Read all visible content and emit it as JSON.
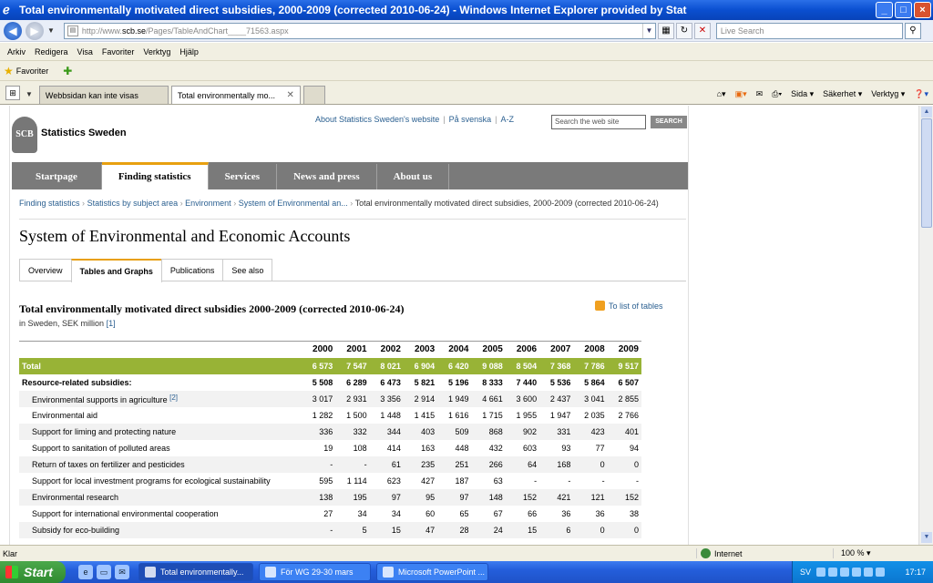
{
  "window": {
    "title": "Total environmentally motivated direct subsidies, 2000-2009 (corrected 2010-06-24) - Windows Internet Explorer provided by Stat",
    "min": "_",
    "max": "□",
    "close": "×"
  },
  "address": {
    "prefix": "http://www.",
    "domain": "scb.se",
    "rest": "/Pages/TableAndChart____71563.aspx",
    "search_placeholder": "Live Search"
  },
  "menu": [
    "Arkiv",
    "Redigera",
    "Visa",
    "Favoriter",
    "Verktyg",
    "Hjälp"
  ],
  "favorites": {
    "label": "Favoriter"
  },
  "tabs": [
    {
      "label": "Webbsidan kan inte visas"
    },
    {
      "label": "Total environmentally mo..."
    }
  ],
  "tab_tools": [
    "Sida ▾",
    "Säkerhet ▾",
    "Verktyg ▾"
  ],
  "site": {
    "logo_text": "SCB",
    "name": "Statistics Sweden",
    "top_links": [
      "About Statistics Sweden's website",
      "På svenska",
      "A-Z"
    ],
    "search_placeholder": "Search the web site",
    "search_button": "SEARCH",
    "nav": [
      "Startpage",
      "Finding statistics",
      "Services",
      "News and press",
      "About us"
    ],
    "breadcrumb": [
      "Finding statistics",
      "Statistics by subject area",
      "Environment",
      "System of Environmental an..."
    ],
    "breadcrumb_current": "Total environmentally motivated direct subsidies, 2000-2009 (corrected 2010-06-24)",
    "heading": "System of Environmental and Economic Accounts",
    "subtabs": [
      "Overview",
      "Tables and Graphs",
      "Publications",
      "See also"
    ],
    "table_title": "Total environmentally motivated direct subsidies 2000-2009 (corrected 2010-06-24)",
    "table_subtitle": "in Sweden, SEK million",
    "table_subtitle_ref": "[1]",
    "to_list": "To list of tables"
  },
  "table": {
    "years": [
      "2000",
      "2001",
      "2002",
      "2003",
      "2004",
      "2005",
      "2006",
      "2007",
      "2008",
      "2009"
    ],
    "rows": [
      {
        "label": "Total",
        "type": "total",
        "values": [
          "6 573",
          "7 547",
          "8 021",
          "6 904",
          "6 420",
          "9 088",
          "8 504",
          "7 368",
          "7 786",
          "9 517"
        ]
      },
      {
        "label": "Resource-related subsidies:",
        "type": "res",
        "values": [
          "5 508",
          "6 289",
          "6 473",
          "5 821",
          "5 196",
          "8 333",
          "7 440",
          "5 536",
          "5 864",
          "6 507"
        ]
      },
      {
        "label": "Environmental supports in agriculture",
        "ref": "[2]",
        "values": [
          "3 017",
          "2 931",
          "3 356",
          "2 914",
          "1 949",
          "4 661",
          "3 600",
          "2 437",
          "3 041",
          "2 855"
        ]
      },
      {
        "label": "Environmental aid",
        "values": [
          "1 282",
          "1 500",
          "1 448",
          "1 415",
          "1 616",
          "1 715",
          "1 955",
          "1 947",
          "2 035",
          "2 766"
        ]
      },
      {
        "label": "Support for liming and protecting nature",
        "values": [
          "336",
          "332",
          "344",
          "403",
          "509",
          "868",
          "902",
          "331",
          "423",
          "401"
        ]
      },
      {
        "label": "Support to sanitation of polluted areas",
        "values": [
          "19",
          "108",
          "414",
          "163",
          "448",
          "432",
          "603",
          "93",
          "77",
          "94"
        ]
      },
      {
        "label": "Return of taxes on fertilizer and pesticides",
        "values": [
          "-",
          "-",
          "61",
          "235",
          "251",
          "266",
          "64",
          "168",
          "0",
          "0"
        ]
      },
      {
        "label": "Support for local investment programs for ecological sustainability",
        "values": [
          "595",
          "1 114",
          "623",
          "427",
          "187",
          "63",
          "-",
          "-",
          "-",
          "-"
        ]
      },
      {
        "label": "Environmental research",
        "values": [
          "138",
          "195",
          "97",
          "95",
          "97",
          "148",
          "152",
          "421",
          "121",
          "152"
        ]
      },
      {
        "label": "Support for international environmental cooperation",
        "values": [
          "27",
          "34",
          "34",
          "60",
          "65",
          "67",
          "66",
          "36",
          "36",
          "38"
        ]
      },
      {
        "label": "Subsidy for eco-building",
        "values": [
          "-",
          "5",
          "15",
          "47",
          "28",
          "24",
          "15",
          "6",
          "0",
          "0"
        ]
      }
    ]
  },
  "status": {
    "left": "Klar",
    "zone": "Internet",
    "zoom": "100 % ▾"
  },
  "taskbar": {
    "start": "Start",
    "items": [
      "Total environmentally...",
      "För WG 29-30 mars",
      "Microsoft PowerPoint ..."
    ],
    "lang": "SV",
    "clock": "17:17"
  }
}
